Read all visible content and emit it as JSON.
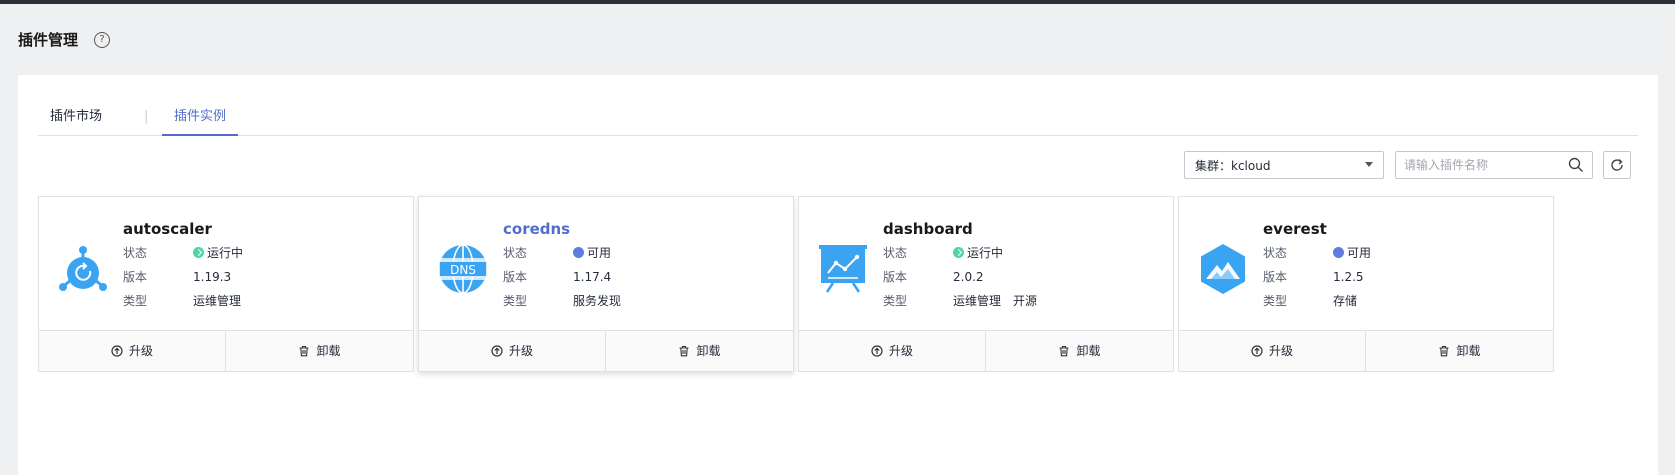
{
  "page": {
    "title": "插件管理",
    "help_icon": "question-circle-icon"
  },
  "tabs": [
    {
      "label": "插件市场",
      "active": false
    },
    {
      "label": "插件实例",
      "active": true
    }
  ],
  "tab_separator": "|",
  "filters": {
    "cluster_label": "集群：kcloud",
    "search_placeholder": "请输入插件名称"
  },
  "card_labels": {
    "status": "状态",
    "version": "版本",
    "type": "类型",
    "upgrade": "升级",
    "uninstall": "卸载"
  },
  "plugins": [
    {
      "name": "autoscaler",
      "status": "运行中",
      "status_kind": "running",
      "version": "1.19.3",
      "types": [
        "运维管理"
      ],
      "icon": "autoscaler-icon"
    },
    {
      "name": "coredns",
      "status": "可用",
      "status_kind": "available",
      "version": "1.17.4",
      "types": [
        "服务发现"
      ],
      "icon": "dns-globe-icon"
    },
    {
      "name": "dashboard",
      "status": "运行中",
      "status_kind": "running",
      "version": "2.0.2",
      "types": [
        "运维管理",
        "开源"
      ],
      "icon": "dashboard-board-icon"
    },
    {
      "name": "everest",
      "status": "可用",
      "status_kind": "available",
      "version": "1.2.5",
      "types": [
        "存储"
      ],
      "icon": "everest-mountain-icon"
    }
  ],
  "colors": {
    "accent": "#526ecc",
    "running": "#50d4ab",
    "available": "#5e7ce0",
    "icon_blue": "#3aa3f2"
  }
}
